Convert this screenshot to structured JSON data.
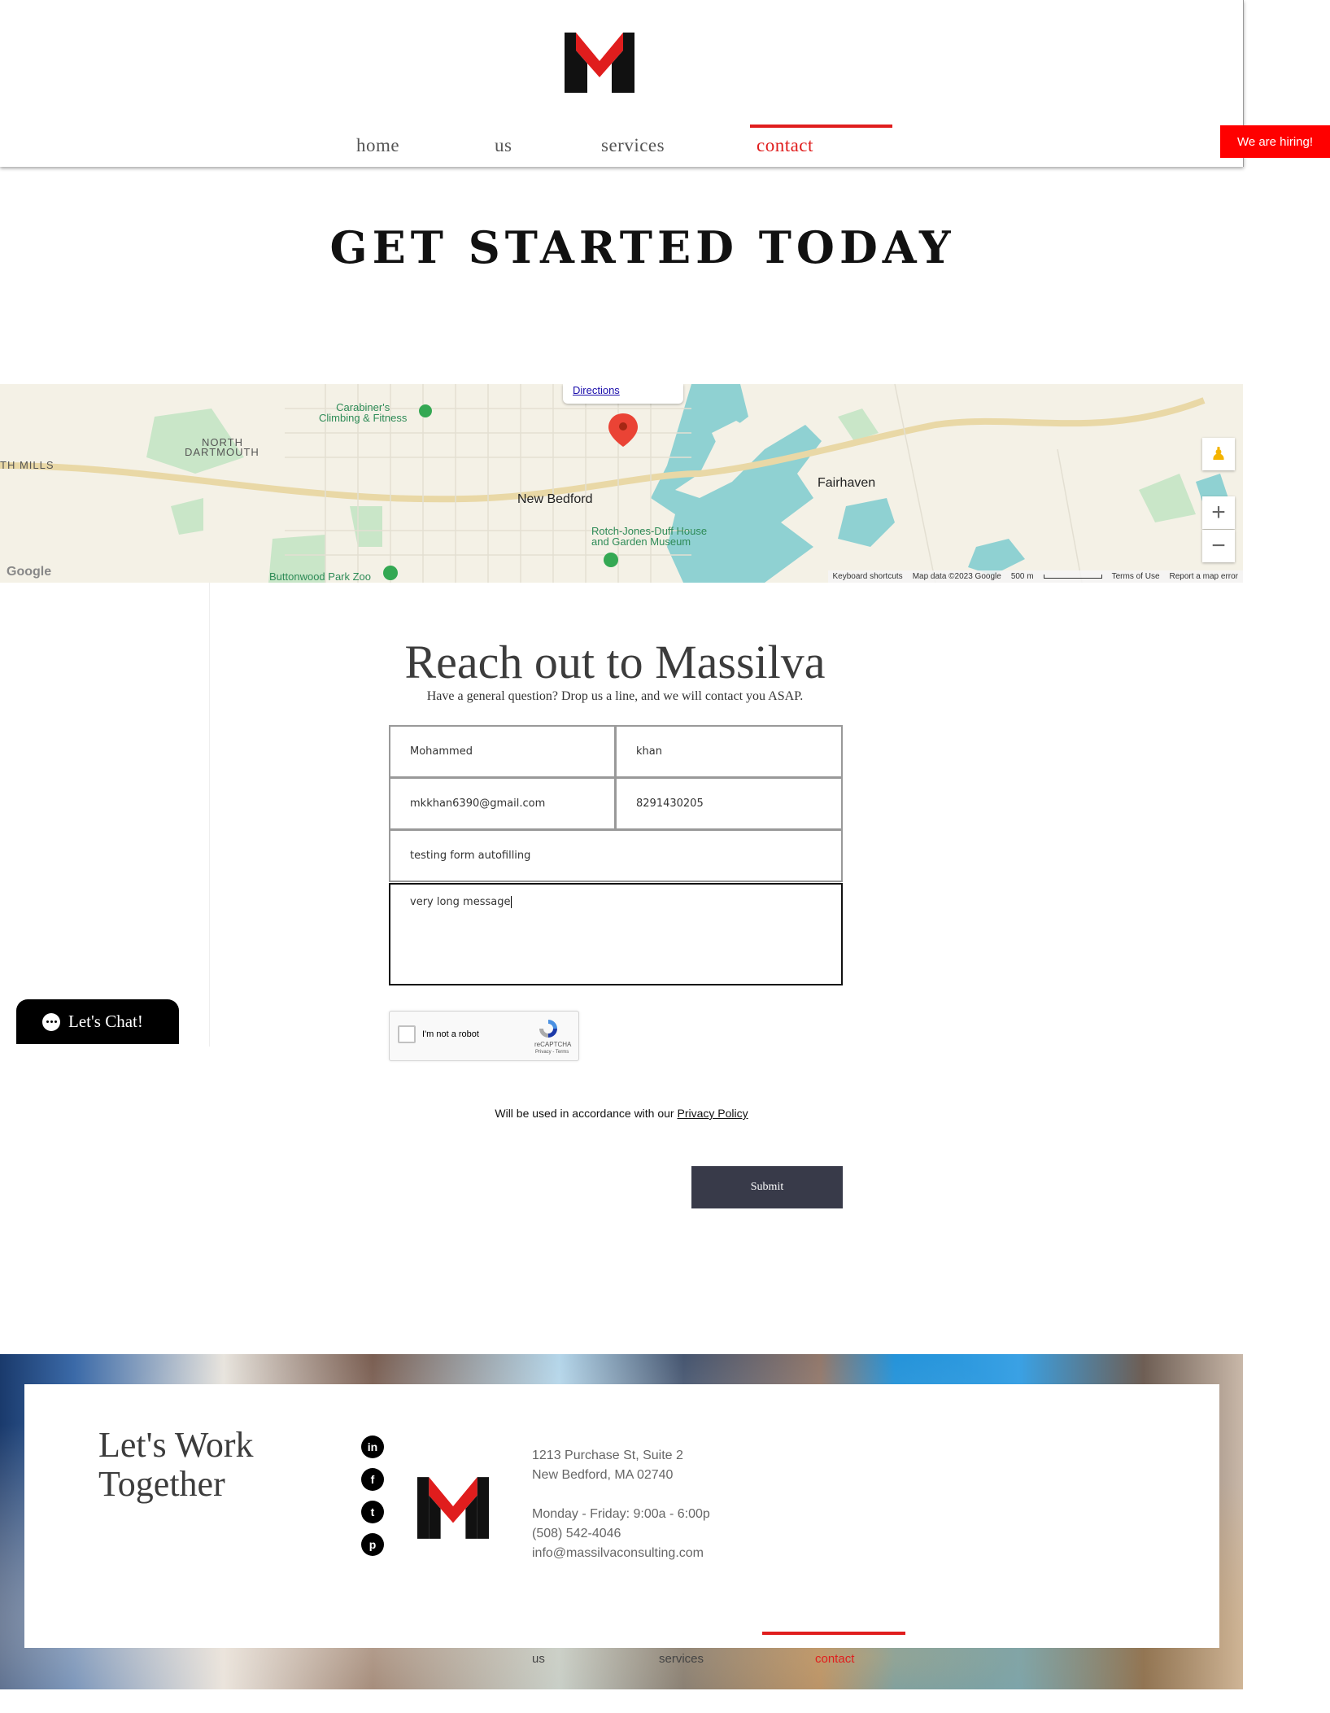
{
  "brand": {
    "accent": "#e01d1d",
    "dark": "#383a49"
  },
  "nav": {
    "items": [
      {
        "label": "home"
      },
      {
        "label": "us"
      },
      {
        "label": "services"
      },
      {
        "label": "contact",
        "active": true
      }
    ]
  },
  "hiring": {
    "label": "We are hiring!"
  },
  "headline": "GET STARTED TODAY",
  "map": {
    "directions": "Directions",
    "labels": {
      "climbing": "Carabiner's\nClimbing & Fitness",
      "north": "NORTH",
      "dartmouth": "DARTMOUTH",
      "mills": "TH MILLS",
      "new_bedford": "New Bedford",
      "fairhaven": "Fairhaven",
      "museum1": "Rotch-Jones-Duff House",
      "museum2": "and Garden Museum",
      "zoo": "Buttonwood Park Zoo",
      "google": "Google"
    },
    "zoom_in": "+",
    "zoom_out": "−",
    "footer": {
      "shortcuts": "Keyboard shortcuts",
      "data": "Map data ©2023 Google",
      "scale": "500 m",
      "terms": "Terms of Use",
      "report": "Report a map error"
    }
  },
  "form": {
    "title": "Reach out to Massilva",
    "subtitle": "Have a general question? Drop us a line, and we will contact you ASAP.",
    "first_name": "Mohammed",
    "last_name": "khan",
    "email": "mkkhan6390@gmail.com",
    "phone": "8291430205",
    "subject": "testing form autofilling",
    "message": "very long message",
    "captcha": {
      "label": "I'm not a robot",
      "brand": "reCAPTCHA",
      "terms": "Privacy - Terms"
    },
    "privacy_prefix": "Will be used in accordance with our ",
    "privacy_link": "Privacy Policy",
    "submit": "Submit"
  },
  "chat": {
    "label": "Let's Chat!"
  },
  "footer": {
    "title_line1": "Let's Work",
    "title_line2": "Together",
    "social": {
      "linkedin": "in",
      "facebook": "f",
      "twitter": "t",
      "pinterest": "p"
    },
    "address1": "1213 Purchase St, Suite 2",
    "address2": "New Bedford, MA 02740",
    "hours": "Monday - Friday: 9:00a - 6:00p",
    "phone": "(508) 542-4046",
    "email": "info@massilvaconsulting.com",
    "nav": {
      "us": "us",
      "services": "services",
      "contact": "contact"
    }
  }
}
